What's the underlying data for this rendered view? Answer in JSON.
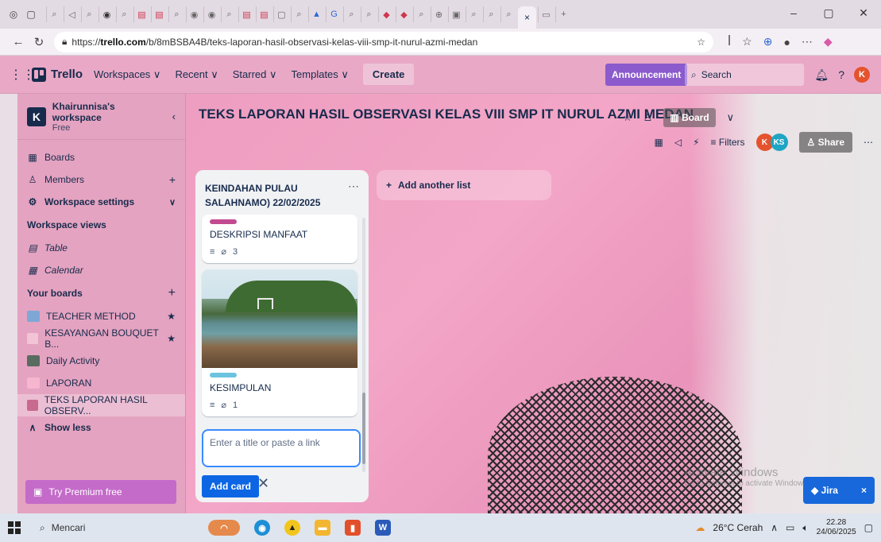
{
  "browser": {
    "url_prefix": "https://",
    "url_host": "trello.com",
    "url_path": "/b/8mBSBA4B/teks-laporan-hasil-observasi-kelas-viii-smp-it-nurul-azmi-medan"
  },
  "header": {
    "app_name": "Trello",
    "nav": [
      "Workspaces ∨",
      "Recent ∨",
      "Starred ∨",
      "Templates ∨"
    ],
    "create_label": "Create",
    "announcement_label": "Announcement",
    "search_placeholder": "Search",
    "avatar_initial": "K"
  },
  "sidebar": {
    "workspace_initial": "K",
    "workspace_name": "Khairunnisa's workspace",
    "plan": "Free",
    "items": [
      {
        "label": "Boards"
      },
      {
        "label": "Members"
      },
      {
        "label": "Workspace settings"
      }
    ],
    "views_heading": "Workspace views",
    "views": [
      {
        "label": "Table"
      },
      {
        "label": "Calendar"
      }
    ],
    "boards_heading": "Your boards",
    "boards": [
      {
        "label": "TEACHER METHOD",
        "color": "#7ea7d6",
        "starred": true
      },
      {
        "label": "KESAYANGAN BOUQUET B...",
        "color": "#f2c4d6",
        "starred": true
      },
      {
        "label": "Daily Activity",
        "color": "#5a6b5f",
        "starred": false
      },
      {
        "label": "LAPORAN",
        "color": "#f6b6cf",
        "starred": false
      },
      {
        "label": "TEKS LAPORAN HASIL OBSERV...",
        "color": "#c86a8e",
        "starred": false
      }
    ],
    "show_less": "Show less",
    "premium_label": "Try Premium free"
  },
  "board": {
    "title": "TEKS LAPORAN HASIL OBSERVASI KELAS VIII SMP IT NURUL AZMI MEDAN",
    "view_label": "Board",
    "filters_label": "Filters",
    "share_label": "Share",
    "members": [
      {
        "initials": "K",
        "color": "#e5532d"
      },
      {
        "initials": "KS",
        "color": "#1fa5c4"
      }
    ],
    "list": {
      "title": "KEINDAHAN PULAU SALAHNAMO) 22/02/2025",
      "cards": [
        {
          "title": "DESKRIPSI MANFAAT",
          "label_color": "#c24b8f",
          "attachments": "3",
          "has_cover": false
        },
        {
          "title": "KESIMPULAN",
          "label_color": "#6cc3e0",
          "attachments": "1",
          "has_cover": true
        }
      ],
      "composer_placeholder": "Enter a title or paste a link",
      "add_card_label": "Add card"
    },
    "add_list_label": "Add another list",
    "watermark_title": "Activate Windows",
    "watermark_sub": "Go to Settings to activate Windows.",
    "jira_label": "Jira"
  },
  "taskbar": {
    "search_label": "Mencari",
    "weather": "26°C  Cerah",
    "time": "22.28",
    "date": "24/06/2025"
  }
}
